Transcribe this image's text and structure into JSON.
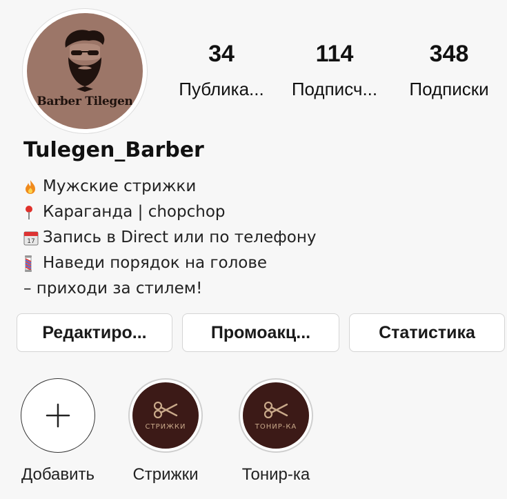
{
  "profile": {
    "avatar_text": "Barber Tilegen",
    "username": "Tulegen_Barber"
  },
  "stats": [
    {
      "value": "34",
      "label": "Публика..."
    },
    {
      "value": "114",
      "label": "Подписч..."
    },
    {
      "value": "348",
      "label": "Подписки"
    }
  ],
  "bio": [
    {
      "icon": "fire-icon",
      "text": "Мужские стрижки"
    },
    {
      "icon": "pin-icon",
      "text": "Караганда | chopchop"
    },
    {
      "icon": "calendar-icon",
      "text": "Запись в Direct или по телефону"
    },
    {
      "icon": "barber-pole-icon",
      "text": "Наведи порядок на голове"
    },
    {
      "icon": "",
      "text": "– приходи за стилем!"
    }
  ],
  "buttons": {
    "edit": "Редактиро...",
    "promo": "Промоакц...",
    "stats": "Статистика"
  },
  "highlights": [
    {
      "label": "Добавить",
      "icon": "plus-icon"
    },
    {
      "label": "Стрижки",
      "caption": "СТРИЖКИ",
      "icon": "scissors-icon"
    },
    {
      "label": "Тонир-ка",
      "caption": "ТОНИР-КА",
      "icon": "scissors-icon"
    }
  ],
  "colors": {
    "avatar_bg": "#9c7668",
    "highlight_bg": "#3c1a17",
    "highlight_accent": "#c9a98a"
  }
}
